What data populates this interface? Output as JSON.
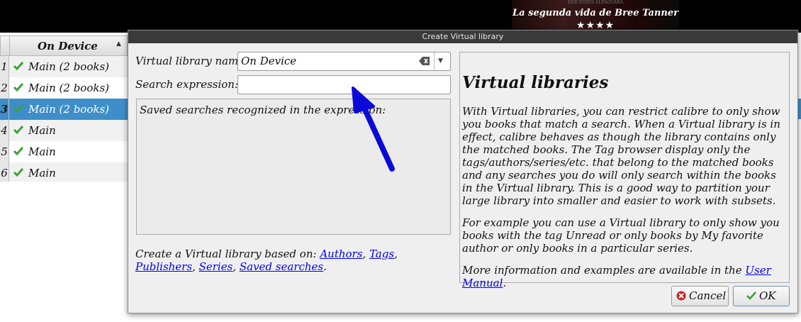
{
  "background": {
    "cover": {
      "title": "La segunda vida de Bree Tanner",
      "rating": "★★★★",
      "top_text": "EDICIONES ALFAGUARA"
    },
    "table": {
      "column_header": "On Device",
      "rows": [
        {
          "num": "1",
          "text": "Main (2 books)"
        },
        {
          "num": "2",
          "text": "Main (2 books)"
        },
        {
          "num": "3",
          "text": "Main (2 books)"
        },
        {
          "num": "4",
          "text": "Main"
        },
        {
          "num": "5",
          "text": "Main"
        },
        {
          "num": "6",
          "text": "Main"
        }
      ],
      "selected_row": 3
    }
  },
  "dialog": {
    "title": "Create Virtual library",
    "name_label": "Virtual library name:",
    "name_value": "On Device",
    "search_label": "Search expression:",
    "search_value": "",
    "saved_searches_text": "Saved searches recognized in the expression:",
    "based_on_label": "Create a Virtual library based on:",
    "based_on_links": {
      "authors": "Authors",
      "tags": "Tags",
      "publishers": "Publishers",
      "series": "Series",
      "saved_searches": "Saved searches"
    },
    "help": {
      "title": "Virtual libraries",
      "p1": "With Virtual libraries, you can restrict calibre to only show you books that match a search. When a Virtual library is in effect, calibre behaves as though the library contains only the matched books. The Tag browser display only the tags/authors/series/etc. that belong to the matched books and any searches you do will only search within the books in the Virtual library. This is a good way to partition your large library into smaller and easier to work with subsets.",
      "p2": "For example you can use a Virtual library to only show you books with the tag Unread or only books by My favorite author or only books in a particular series.",
      "p3_prefix": "More information and examples are available in the",
      "p3_link": "User Manual",
      "p3_suffix": "."
    },
    "buttons": {
      "cancel": "Cancel",
      "ok": "OK"
    }
  },
  "colors": {
    "selection": "#3d8ec9",
    "link": "#0000ee",
    "annotation_arrow": "#0a0ad8",
    "check_green": "#3aa335",
    "cancel_red": "#cc2222"
  },
  "icons": [
    "checkmark-icon",
    "clear-text-icon",
    "chevron-down-icon",
    "cancel-icon",
    "ok-check-icon",
    "sort-arrow-icon"
  ]
}
